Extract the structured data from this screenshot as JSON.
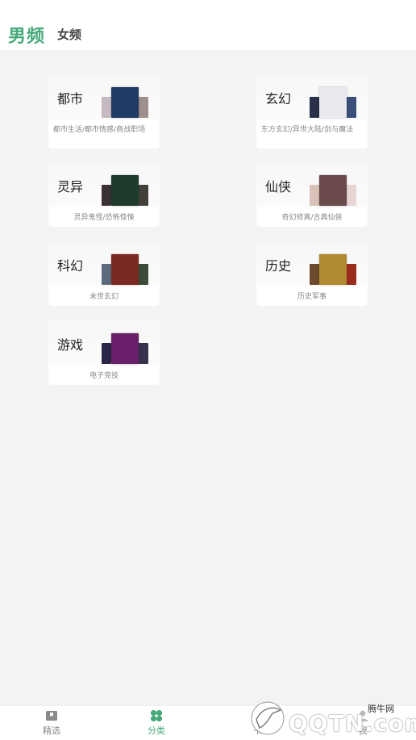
{
  "header": {
    "tabs": [
      {
        "label": "男频",
        "active": true
      },
      {
        "label": "女频",
        "active": false
      }
    ]
  },
  "categories": [
    {
      "title": "都市",
      "subtitle": "都市生活/都市情感/商战职场",
      "colors": [
        "#c7b9c2",
        "#1f3c64",
        "#9f8f8f"
      ]
    },
    {
      "title": "玄幻",
      "subtitle": "东方玄幻/异世大陆/剑与魔法",
      "colors": [
        "#2a2f4a",
        "#e9e9ef",
        "#3a4f7a"
      ]
    },
    {
      "title": "灵异",
      "subtitle": "灵异鬼怪/恐怖惊悚",
      "colors": [
        "#3a3036",
        "#1f3b2c",
        "#43403a"
      ]
    },
    {
      "title": "仙侠",
      "subtitle": "奇幻修真/古典仙侠",
      "colors": [
        "#d9c3b8",
        "#6a4a4a",
        "#e8d6d6"
      ]
    },
    {
      "title": "科幻",
      "subtitle": "未世玄幻",
      "colors": [
        "#5b6b7c",
        "#7a2a22",
        "#3b4c3a"
      ]
    },
    {
      "title": "历史",
      "subtitle": "历史军事",
      "colors": [
        "#6c4a2c",
        "#b08a32",
        "#9a2a1c"
      ]
    },
    {
      "title": "游戏",
      "subtitle": "电子竞技",
      "colors": [
        "#2a2446",
        "#6a1f6a",
        "#38324e"
      ]
    }
  ],
  "bottom_nav": [
    {
      "label": "精选",
      "icon": "bookmark-icon",
      "active": false
    },
    {
      "label": "分类",
      "icon": "grid-icon",
      "active": true
    },
    {
      "label": "书",
      "icon": "book-icon",
      "active": false
    },
    {
      "label": "我",
      "icon": "user-icon",
      "active": false
    }
  ],
  "watermark": {
    "top_text": "腾牛网",
    "main_text": "QQTN.com"
  },
  "accent_color": "#47a97b"
}
